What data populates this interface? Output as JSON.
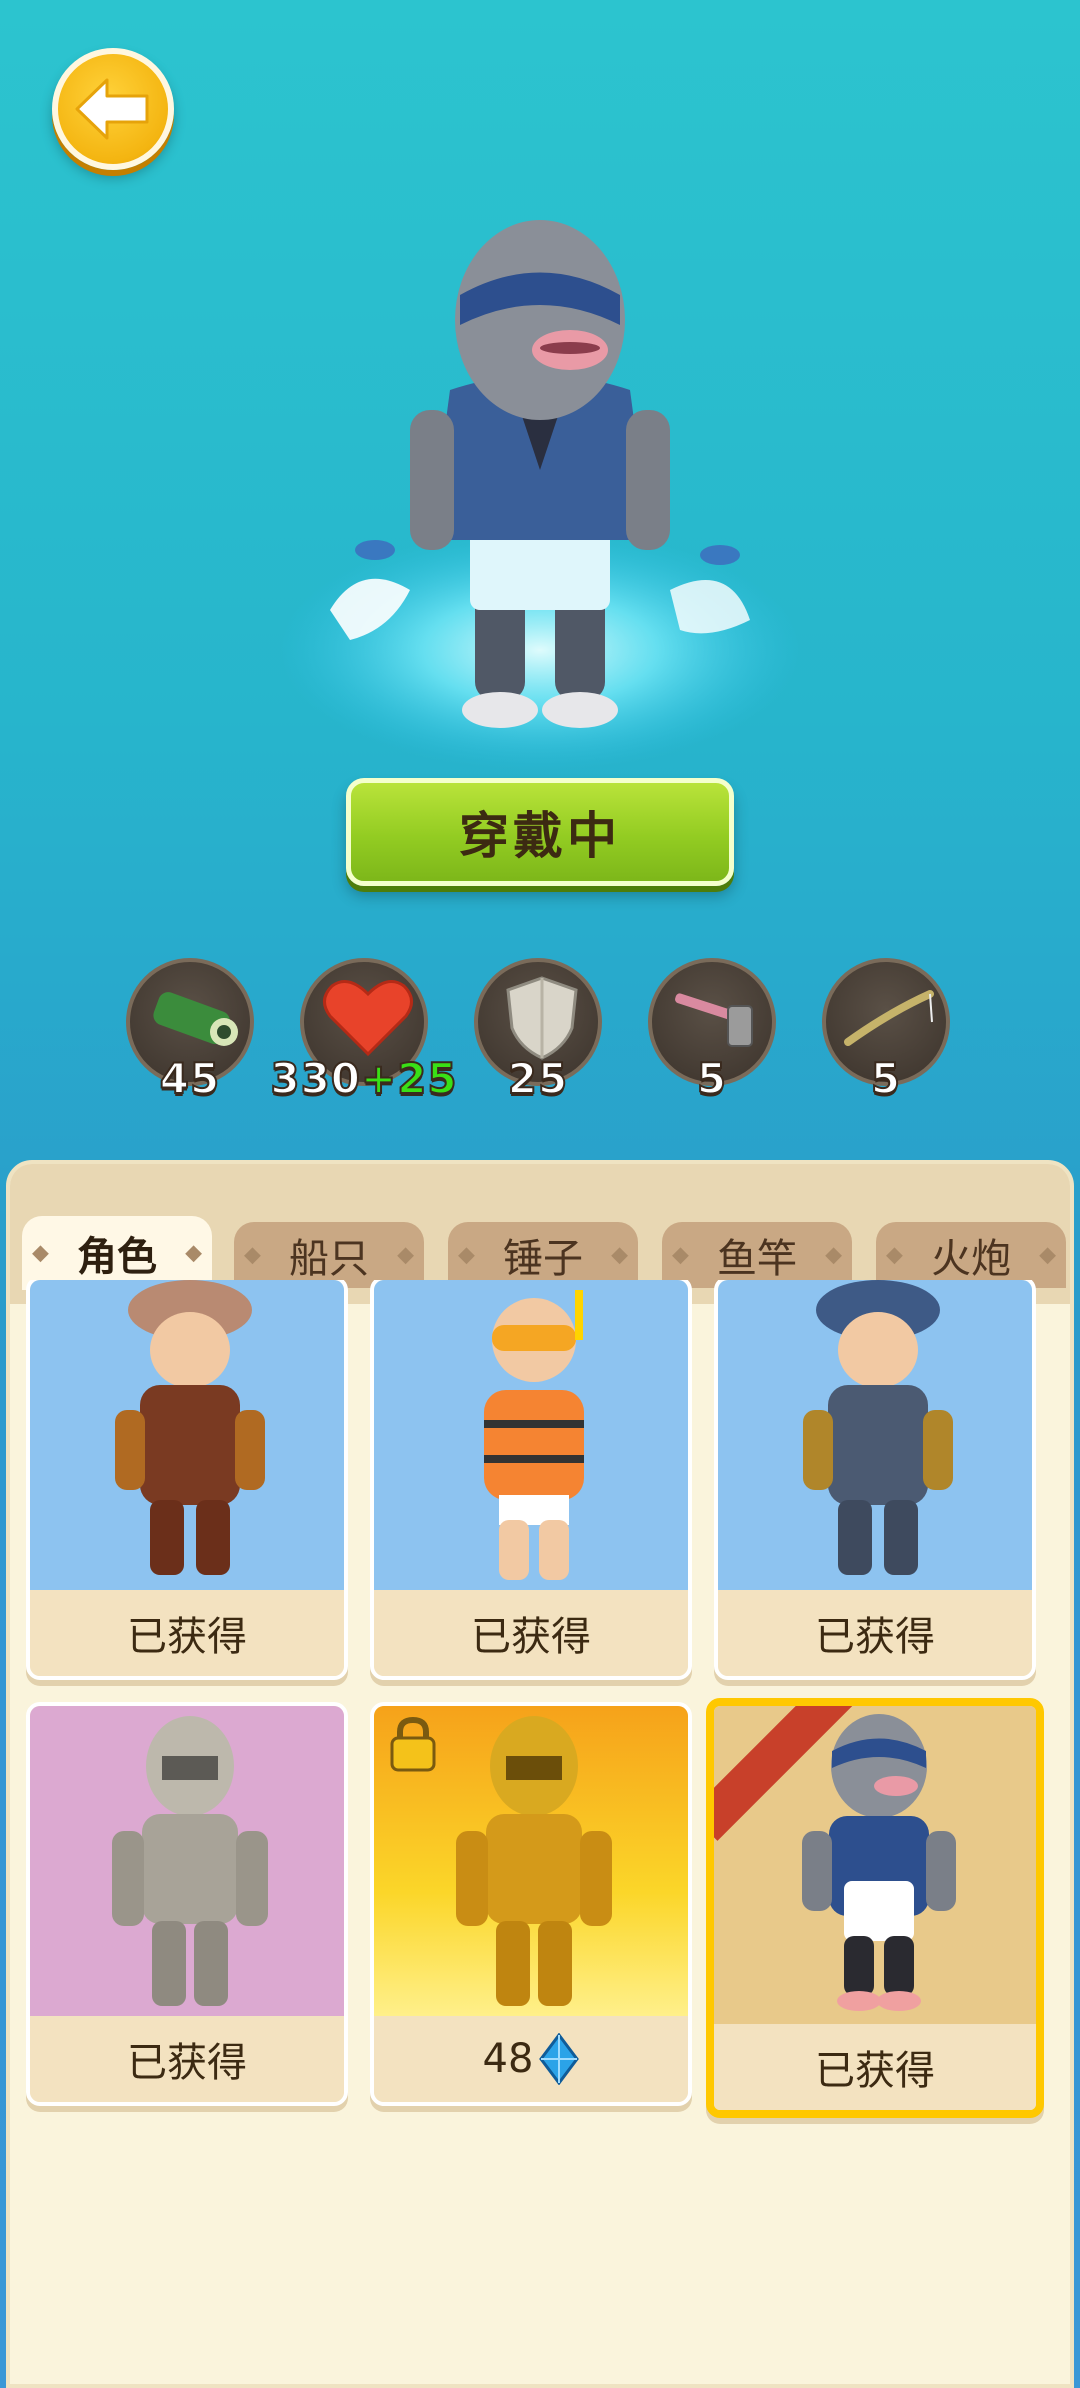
{
  "equip_button": {
    "label": "穿戴中"
  },
  "stats": [
    {
      "icon": "cannon-icon",
      "value": "45",
      "bonus": ""
    },
    {
      "icon": "heart-icon",
      "value": "330",
      "bonus": "+25"
    },
    {
      "icon": "shield-icon",
      "value": "25",
      "bonus": ""
    },
    {
      "icon": "hammer-icon",
      "value": "5",
      "bonus": ""
    },
    {
      "icon": "fishing-rod-icon",
      "value": "5",
      "bonus": ""
    }
  ],
  "tabs": [
    {
      "label": "角色",
      "active": true
    },
    {
      "label": "船只",
      "active": false
    },
    {
      "label": "锤子",
      "active": false
    },
    {
      "label": "鱼竿",
      "active": false
    },
    {
      "label": "火炮",
      "active": false
    }
  ],
  "characters": [
    {
      "name": "farmer-brown",
      "status": "已获得",
      "bg": "#8dc3f0"
    },
    {
      "name": "swimmer-life-vest",
      "status": "已获得",
      "bg": "#8dc3f0"
    },
    {
      "name": "farmer-blue",
      "status": "已获得",
      "bg": "#8dc3f0"
    },
    {
      "name": "knight-silver",
      "status": "已获得",
      "bg": "#dca9d1"
    },
    {
      "name": "knight-gold",
      "price": "48",
      "currency_icon": "diamond-icon",
      "locked": true,
      "bg": "#fbc21d"
    },
    {
      "name": "fish-head-ninja",
      "status": "已获得",
      "bg": "#e8c98a",
      "selected": true
    }
  ],
  "colors": {
    "accent": "#ffc800",
    "bonus": "#39e016",
    "equip": "#93cc22"
  }
}
